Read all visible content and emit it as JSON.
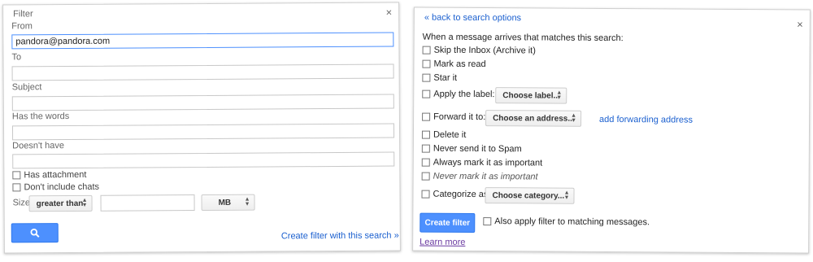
{
  "left": {
    "title": "Filter",
    "close": "×",
    "from_label": "From",
    "from_value": "pandora@pandora.com",
    "to_label": "To",
    "subject_label": "Subject",
    "has_words_label": "Has the words",
    "doesnt_have_label": "Doesn't have",
    "has_attachment": "Has attachment",
    "dont_include_chats": "Don't include chats",
    "size_label": "Size",
    "size_operator": "greater than",
    "size_unit": "MB",
    "create_filter_link": "Create filter with this search »"
  },
  "right": {
    "back_link": "« back to search options",
    "close": "×",
    "intro": "When a message arrives that matches this search:",
    "options": [
      "Skip the Inbox (Archive it)",
      "Mark as read",
      "Star it",
      "Apply the label:",
      "Forward it to:",
      "Delete it",
      "Never send it to Spam",
      "Always mark it as important",
      "Never mark it as important",
      "Categorize as:"
    ],
    "choose_label": "Choose label...",
    "choose_address": "Choose an address...",
    "add_forwarding": "add forwarding address",
    "choose_category": "Choose category...",
    "create_filter_button": "Create filter",
    "also_apply": "Also apply filter to matching messages.",
    "learn_more": "Learn more"
  },
  "colors": {
    "accent": "#4d90fe",
    "link": "#1a5fcf"
  }
}
